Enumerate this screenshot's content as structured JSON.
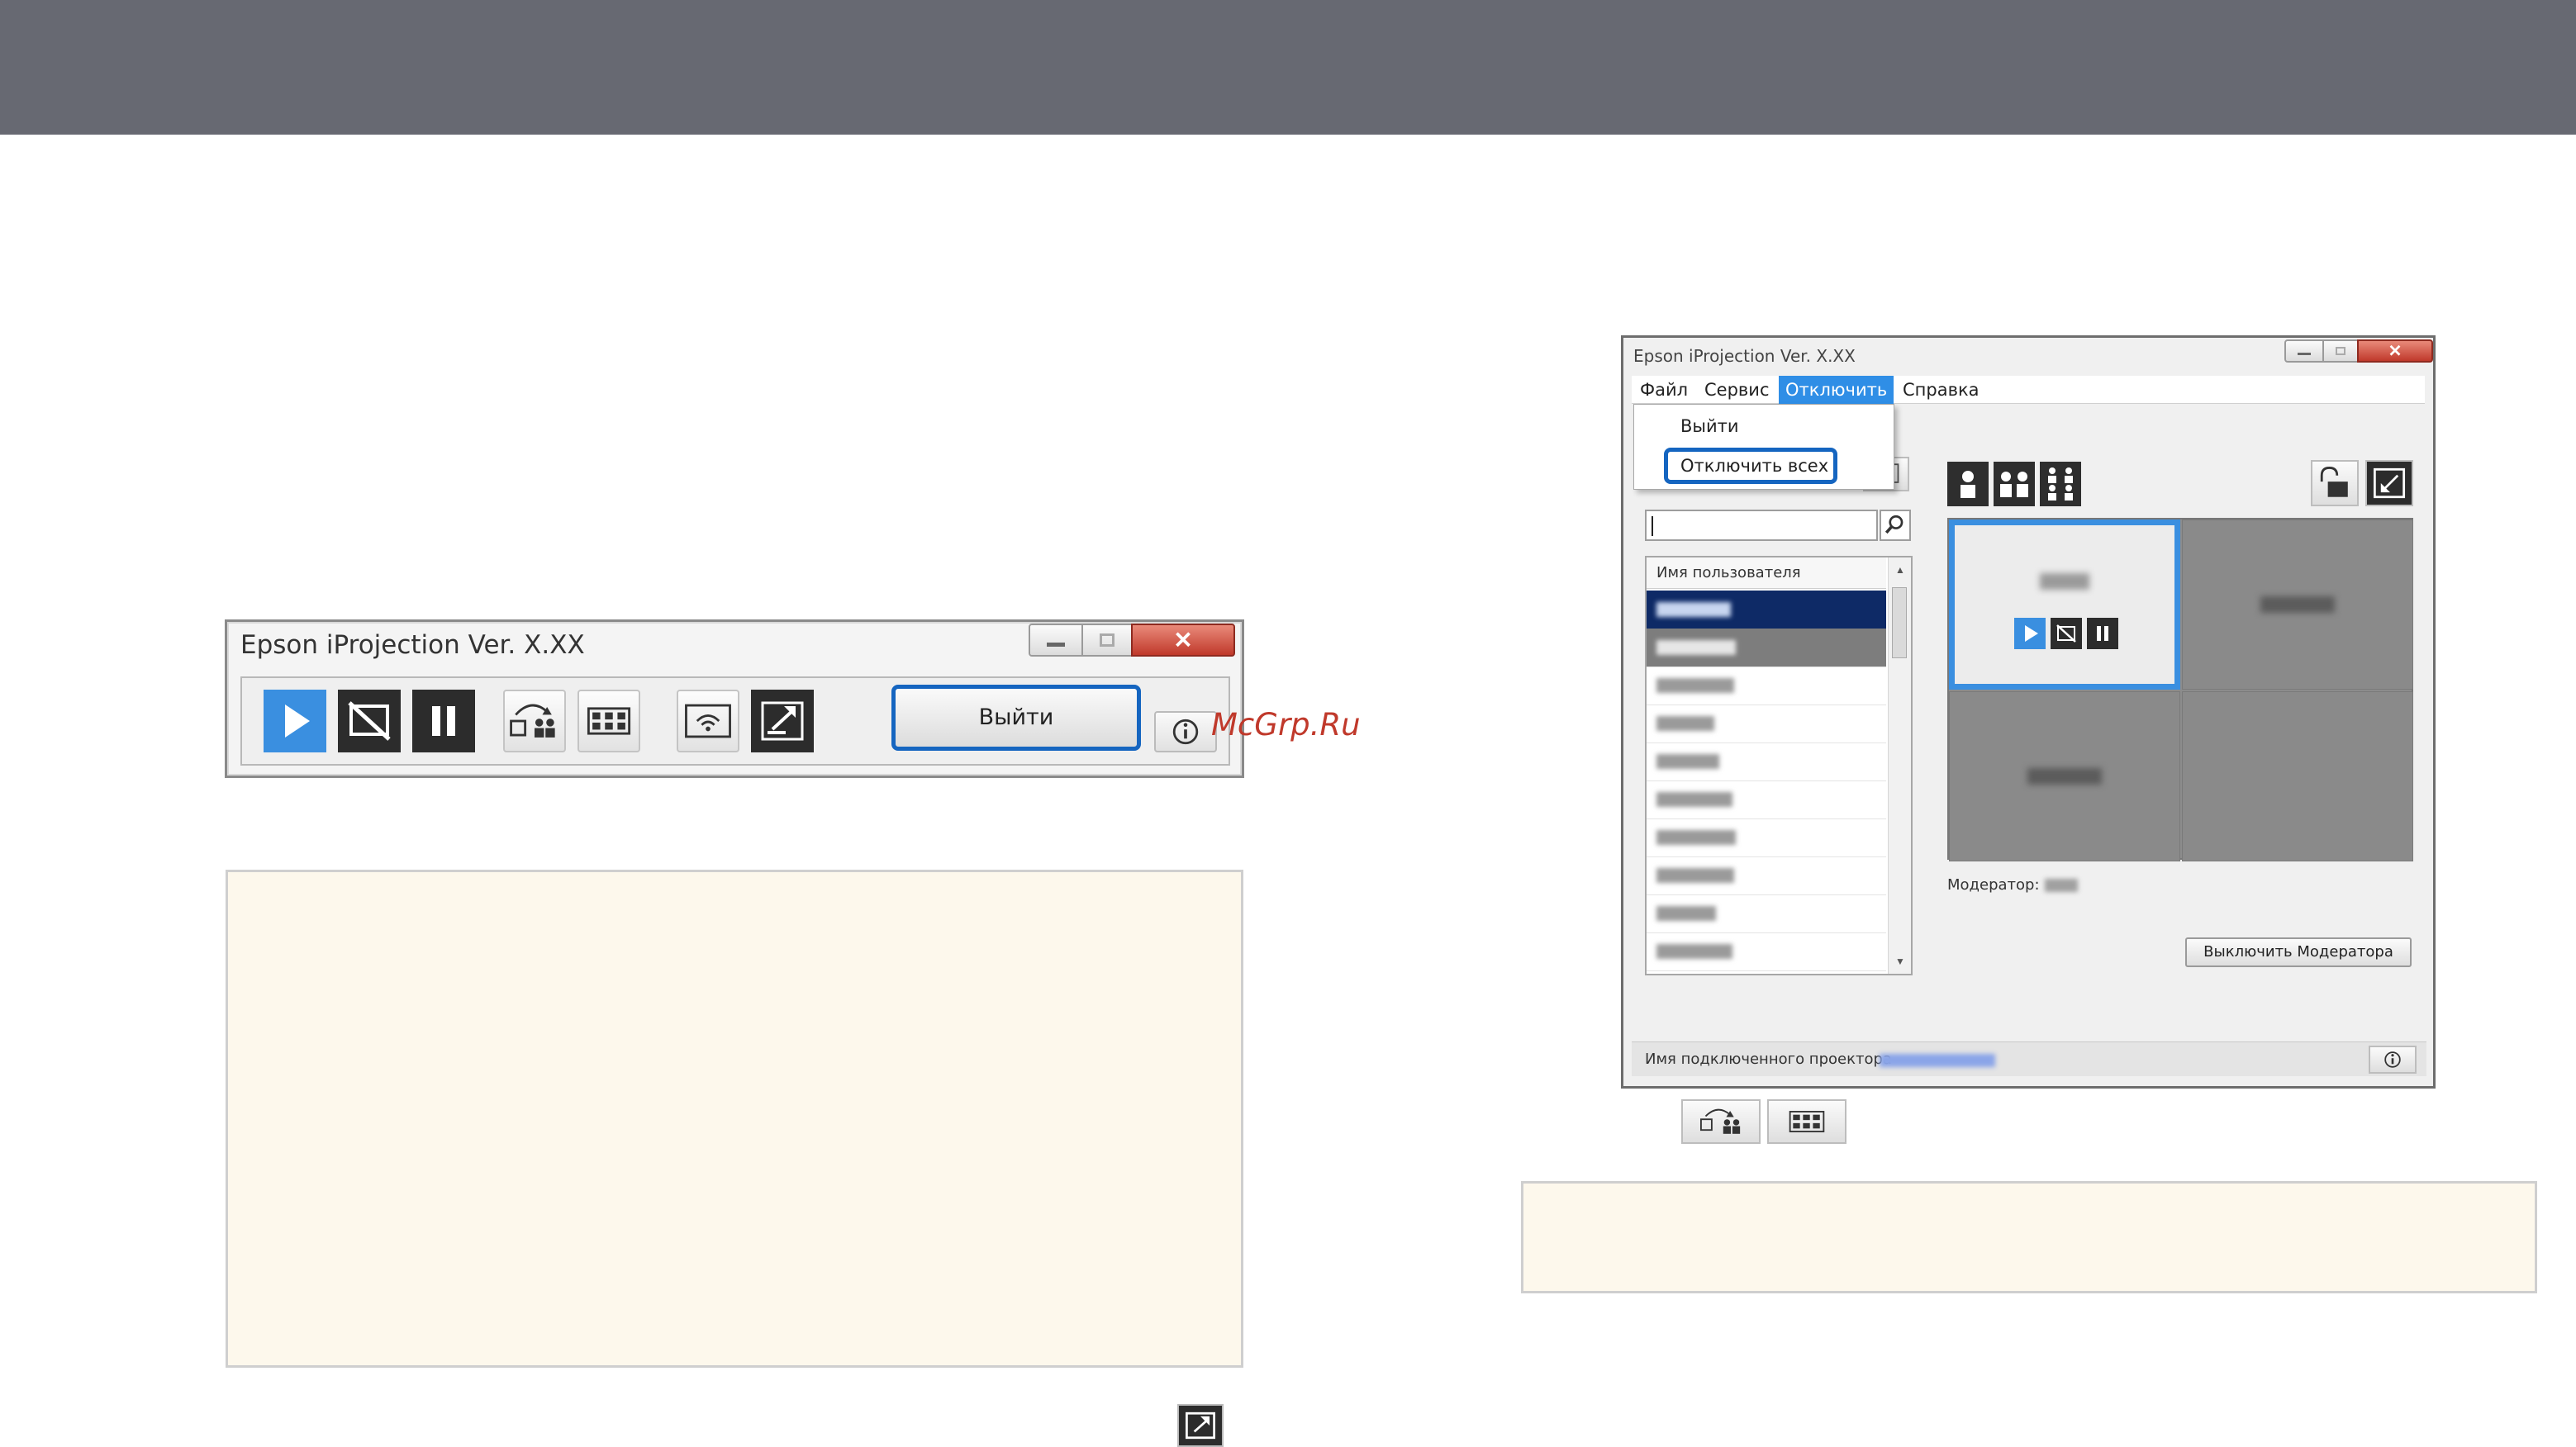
{
  "toolbar_window": {
    "title": "Epson iProjection Ver. X.XX",
    "exit_button_label": "Выйти"
  },
  "watermark": "McGrp.Ru",
  "main_window": {
    "title": "Epson iProjection Ver. X.XX",
    "menu": [
      {
        "label": "Файл",
        "active": false
      },
      {
        "label": "Сервис",
        "active": false
      },
      {
        "label": "Отключить",
        "active": true
      },
      {
        "label": "Справка",
        "active": false
      }
    ],
    "dropdown": {
      "items": [
        "Выйти",
        "Отключить всех"
      ],
      "highlighted": "Отключить всех"
    },
    "user_list_header": "Имя пользователя",
    "moderator_label": "Модератор:",
    "moderator_off_button": "Выключить Модератора",
    "connected_projector_label": "Имя подключенного проектора"
  },
  "colors": {
    "header_band": "#676972",
    "accent_blue": "#3a8fe0",
    "highlight_outline": "#1565c0",
    "note_background": "#fdf8ec",
    "watermark": "#c0392b"
  }
}
